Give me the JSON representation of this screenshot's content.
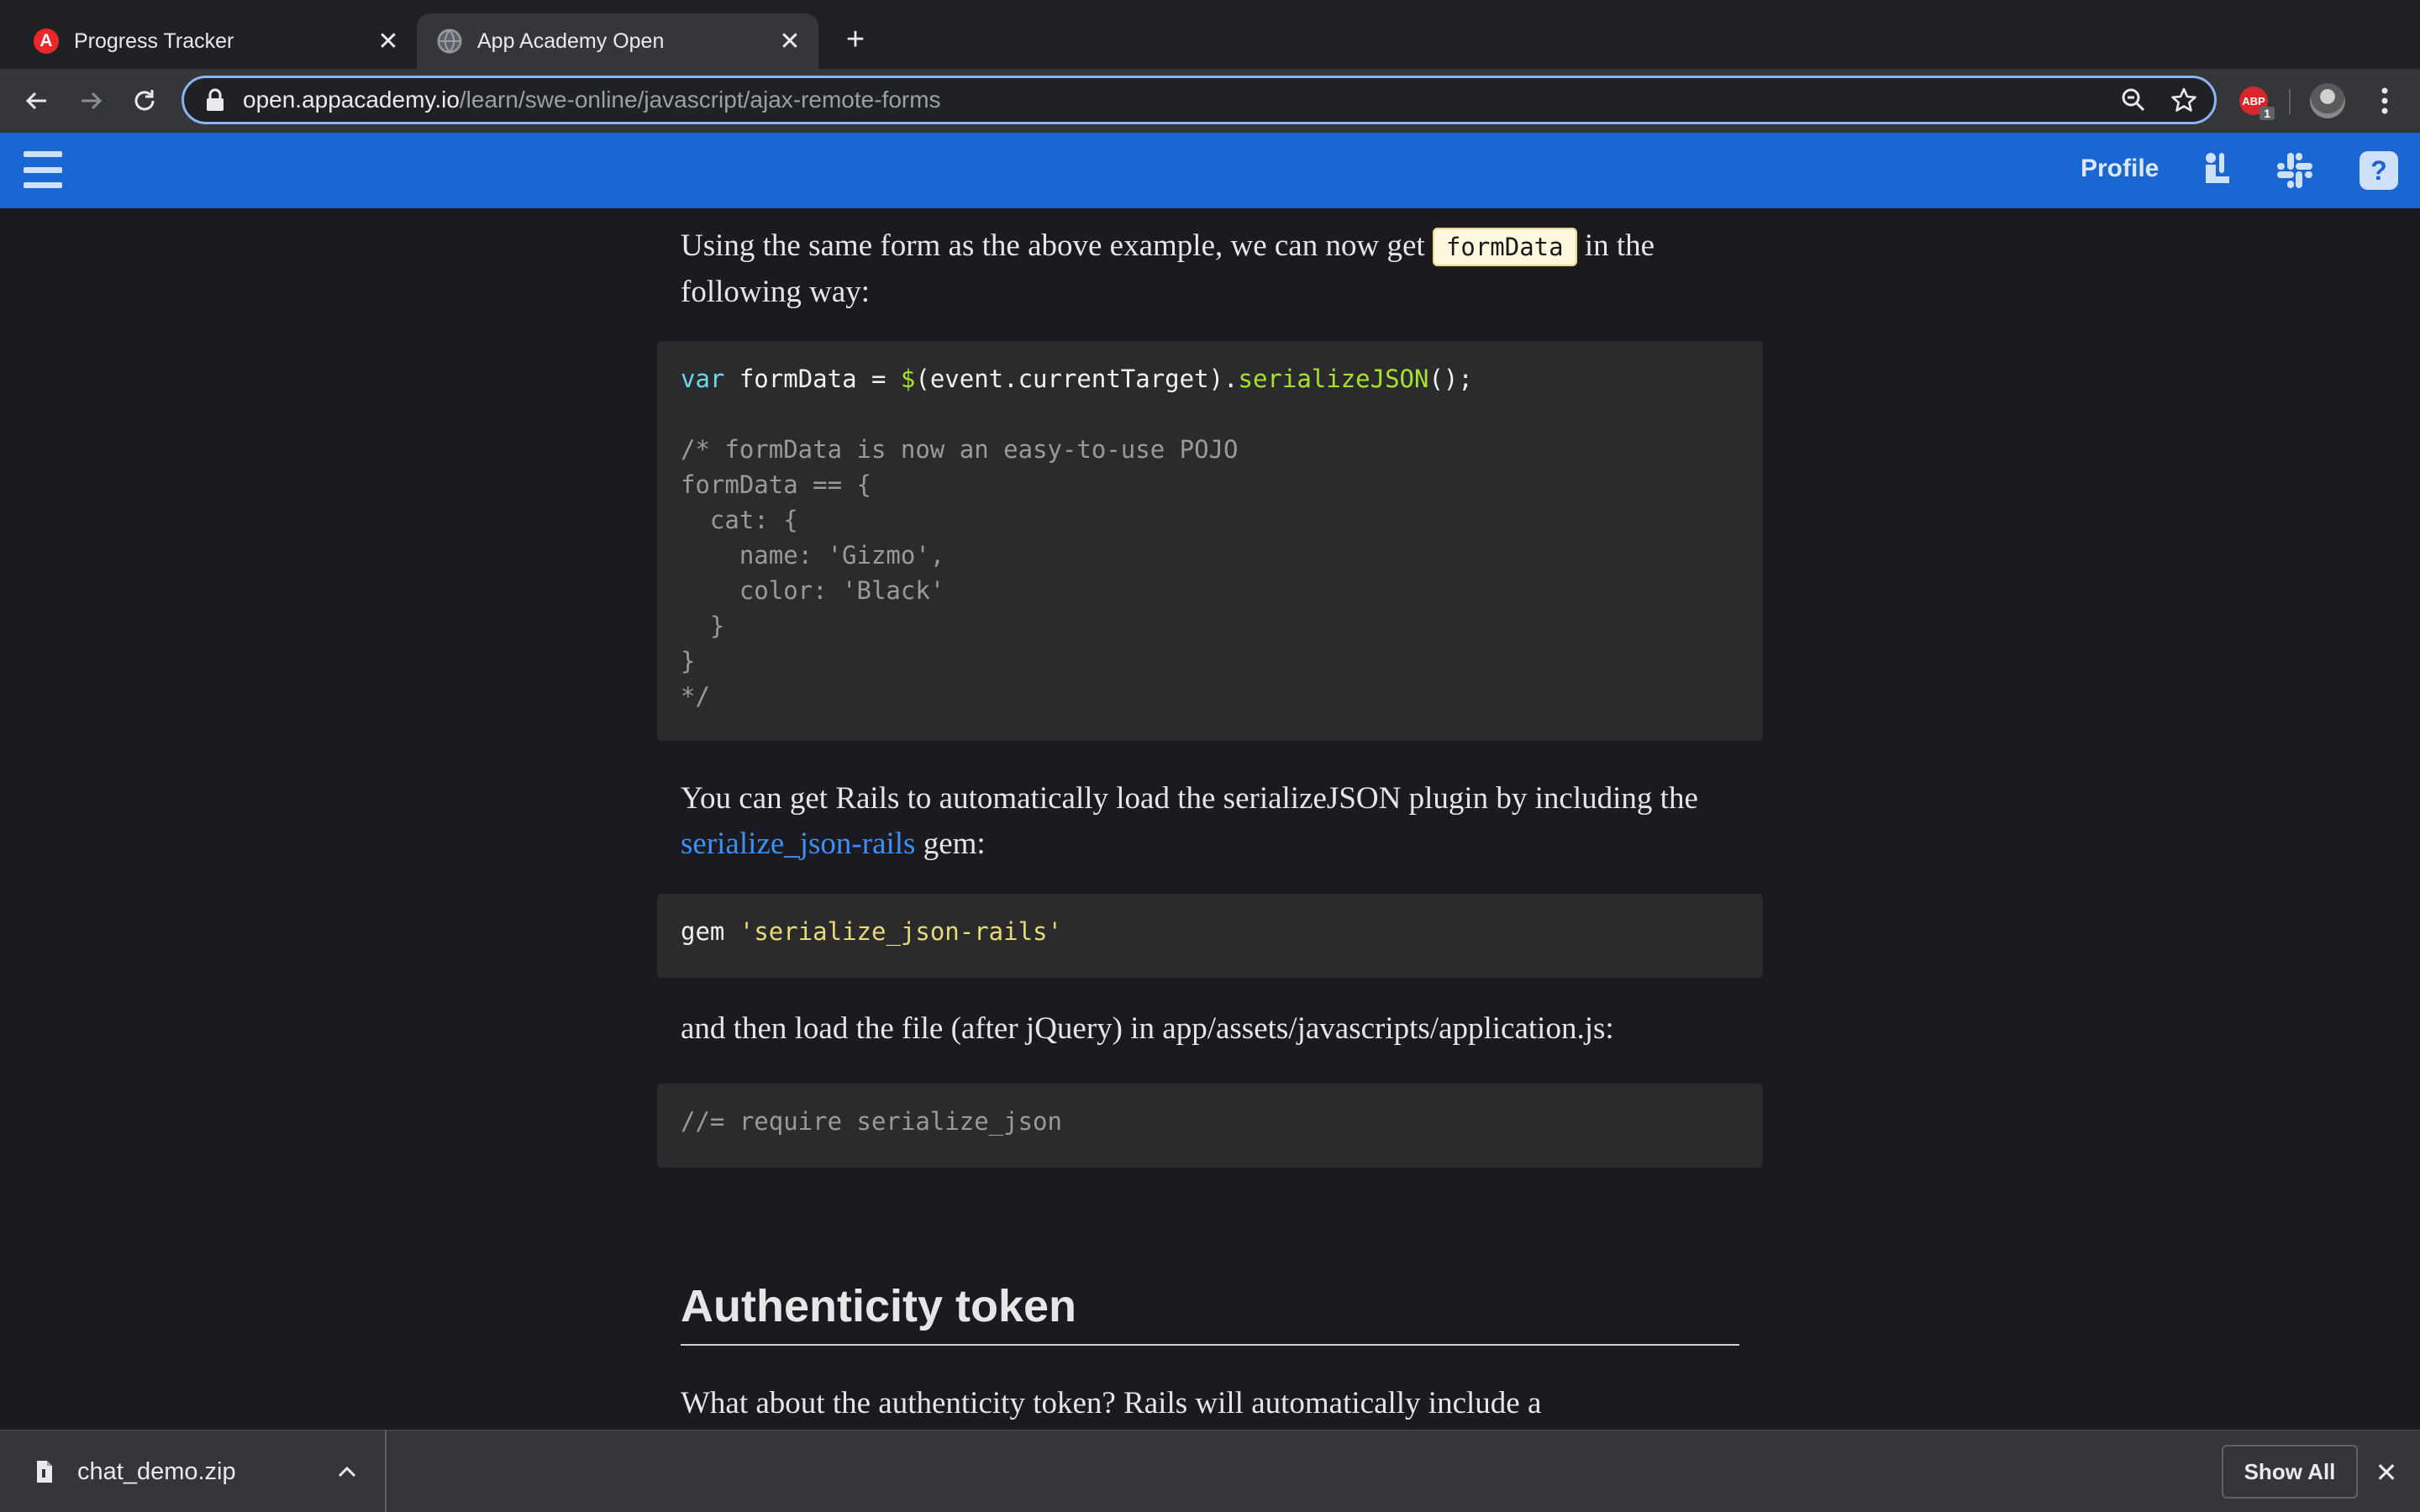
{
  "browser": {
    "tabs": [
      {
        "title": "Progress Tracker",
        "favicon": "A",
        "favicon_color": "#e8272a",
        "active": false
      },
      {
        "title": "App Academy Open",
        "favicon": "globe-icon",
        "active": true
      }
    ],
    "close_glyph": "✕",
    "new_tab_glyph": "+",
    "url_host": "open.appacademy.io",
    "url_path": "/learn/swe-online/javascript/ajax-remote-forms",
    "extension_badge": "ABP",
    "extension_count": "1"
  },
  "site": {
    "brand_color": "#1a66d2",
    "profile_label": "Profile"
  },
  "content": {
    "para1_before": "Using the same form as the above example, we can now get ",
    "para1_code": "formData",
    "para1_after": " in the following way:",
    "code1": {
      "l1_kw": "var",
      "l1_mid": " formData = ",
      "l1_fn1": "$",
      "l1_mid2": "(event.currentTarget).",
      "l1_fn2": "serializeJSON",
      "l1_end": "();",
      "comment": "/* formData is now an easy-to-use POJO\nformData == {\n  cat: {\n    name: 'Gizmo',\n    color: 'Black'\n  }\n}\n*/"
    },
    "para2_before": "You can get Rails to automatically load the serializeJSON plugin by including the ",
    "para2_link": "serialize_json-rails",
    "para2_after": " gem:",
    "code2": {
      "kw": "gem",
      "str": "'serialize_json-rails'"
    },
    "para3": "and then load the file (after jQuery) in app/assets/javascripts/application.js:",
    "code3": "//= require serialize_json",
    "heading": "Authenticity token",
    "para4": "What about the authenticity token? Rails will automatically include a"
  },
  "downloads": {
    "file_name": "chat_demo.zip",
    "show_all_label": "Show All",
    "close_glyph": "✕"
  }
}
